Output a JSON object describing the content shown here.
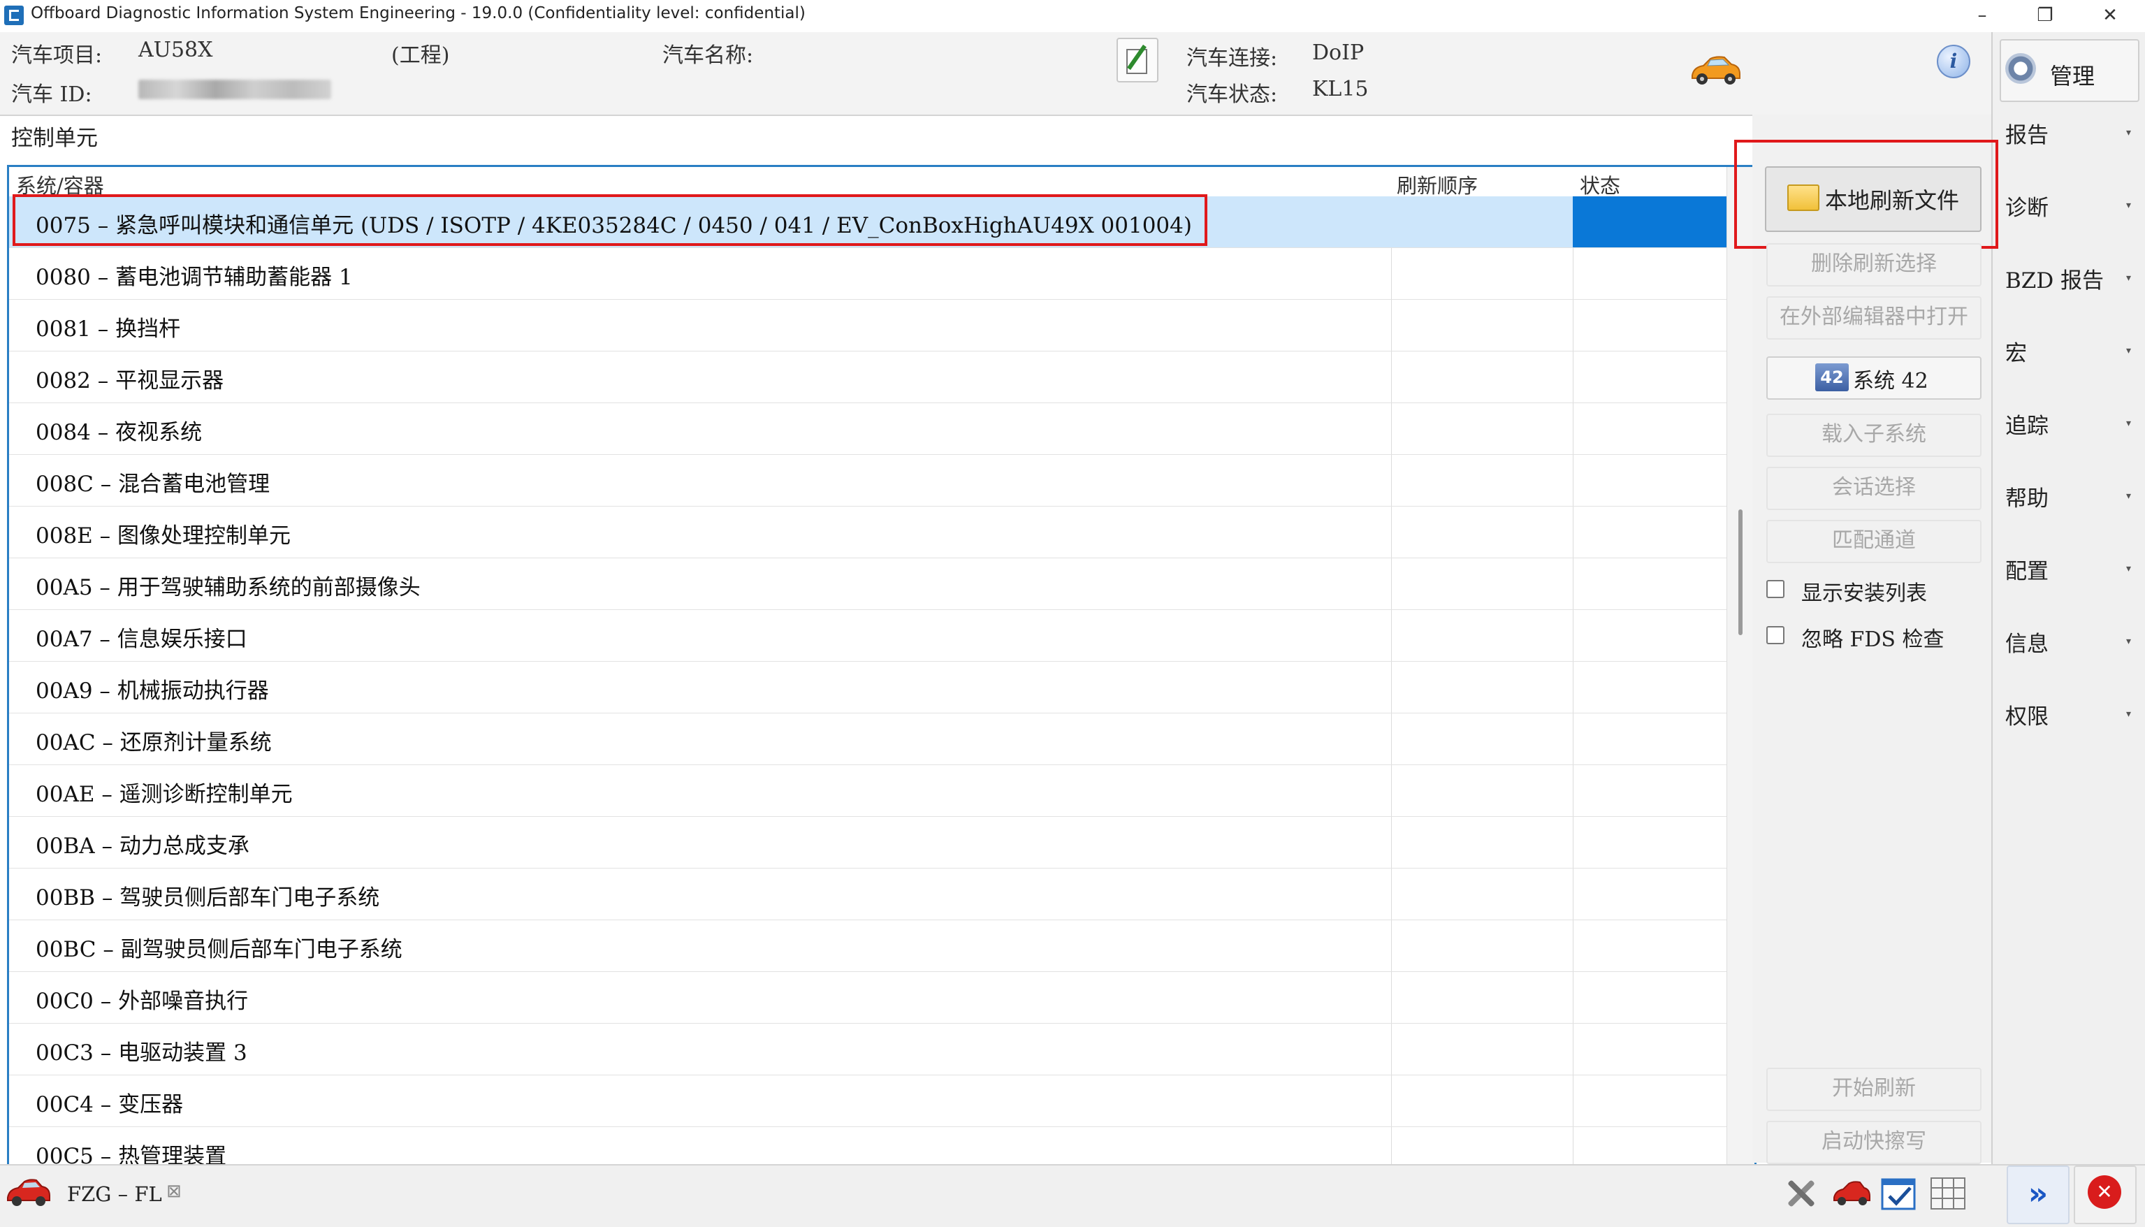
{
  "window": {
    "title": "Offboard Diagnostic Information System Engineering - 19.0.0 (Confidentiality level: confidential)",
    "minimize_label": "–",
    "maximize_label": "❐",
    "close_label": "✕"
  },
  "header": {
    "project_label": "汽车项目:",
    "project_value": "AU58X",
    "project_type": "(工程)",
    "vehicle_name_label": "汽车名称:",
    "vehicle_id_label": "汽车 ID:",
    "connection_label": "汽车连接:",
    "connection_value": "DoIP",
    "state_label": "汽车状态:",
    "state_value": "KL15",
    "info_icon_glyph": "i"
  },
  "right_menu": {
    "manage_label": "管理",
    "items": [
      {
        "label": "报告"
      },
      {
        "label": "诊断"
      },
      {
        "label": "BZD 报告"
      },
      {
        "label": "宏"
      },
      {
        "label": "追踪"
      },
      {
        "label": "帮助"
      },
      {
        "label": "配置"
      },
      {
        "label": "信息"
      },
      {
        "label": "权限"
      }
    ],
    "caret": "▾"
  },
  "section": {
    "title": "控制单元"
  },
  "table": {
    "columns": [
      "系统/容器",
      "刷新顺序",
      "状态"
    ],
    "rows": [
      {
        "text": "0075 – 紧急呼叫模块和通信单元  (UDS / ISOTP / 4KE035284C / 0450 / 041 / EV_ConBoxHighAU49X 001004)",
        "selected": true
      },
      {
        "text": "0080 – 蓄电池调节辅助蓄能器 1"
      },
      {
        "text": "0081 – 换挡杆"
      },
      {
        "text": "0082 – 平视显示器"
      },
      {
        "text": "0084 – 夜视系统"
      },
      {
        "text": "008C – 混合蓄电池管理"
      },
      {
        "text": "008E – 图像处理控制单元"
      },
      {
        "text": "00A5 – 用于驾驶辅助系统的前部摄像头"
      },
      {
        "text": "00A7 – 信息娱乐接口"
      },
      {
        "text": "00A9 – 机械振动执行器"
      },
      {
        "text": "00AC – 还原剂计量系统"
      },
      {
        "text": "00AE – 遥测诊断控制单元"
      },
      {
        "text": "00BA – 动力总成支承"
      },
      {
        "text": "00BB – 驾驶员侧后部车门电子系统"
      },
      {
        "text": "00BC – 副驾驶员侧后部车门电子系统"
      },
      {
        "text": "00C0 – 外部噪音执行"
      },
      {
        "text": "00C3 – 电驱动装置 3"
      },
      {
        "text": "00C4 – 变压器"
      },
      {
        "text": "00C5 – 热管理装置"
      }
    ]
  },
  "actions": {
    "local_flash_file": "本地刷新文件",
    "delete_flash_selection": "删除刷新选择",
    "open_external_editor": "在外部编辑器中打开",
    "system_icon_text": "42",
    "system_label": "系统 42",
    "load_subsystem": "载入子系统",
    "session_selection": "会话选择",
    "adaptation_channel": "匹配通道",
    "show_install_list": "显示安装列表",
    "ignore_fds_check": "忽略 FDS 检查",
    "start_flash": "开始刷新",
    "start_quick_erase": "启动快擦写"
  },
  "bottom": {
    "tab_label": "FZG – FL",
    "tab_close": "⊠",
    "next_glyph": "»"
  },
  "colors": {
    "accent_blue": "#2a7fc4",
    "selection_blue": "#0a78d7",
    "highlight_red": "#e0191b"
  }
}
